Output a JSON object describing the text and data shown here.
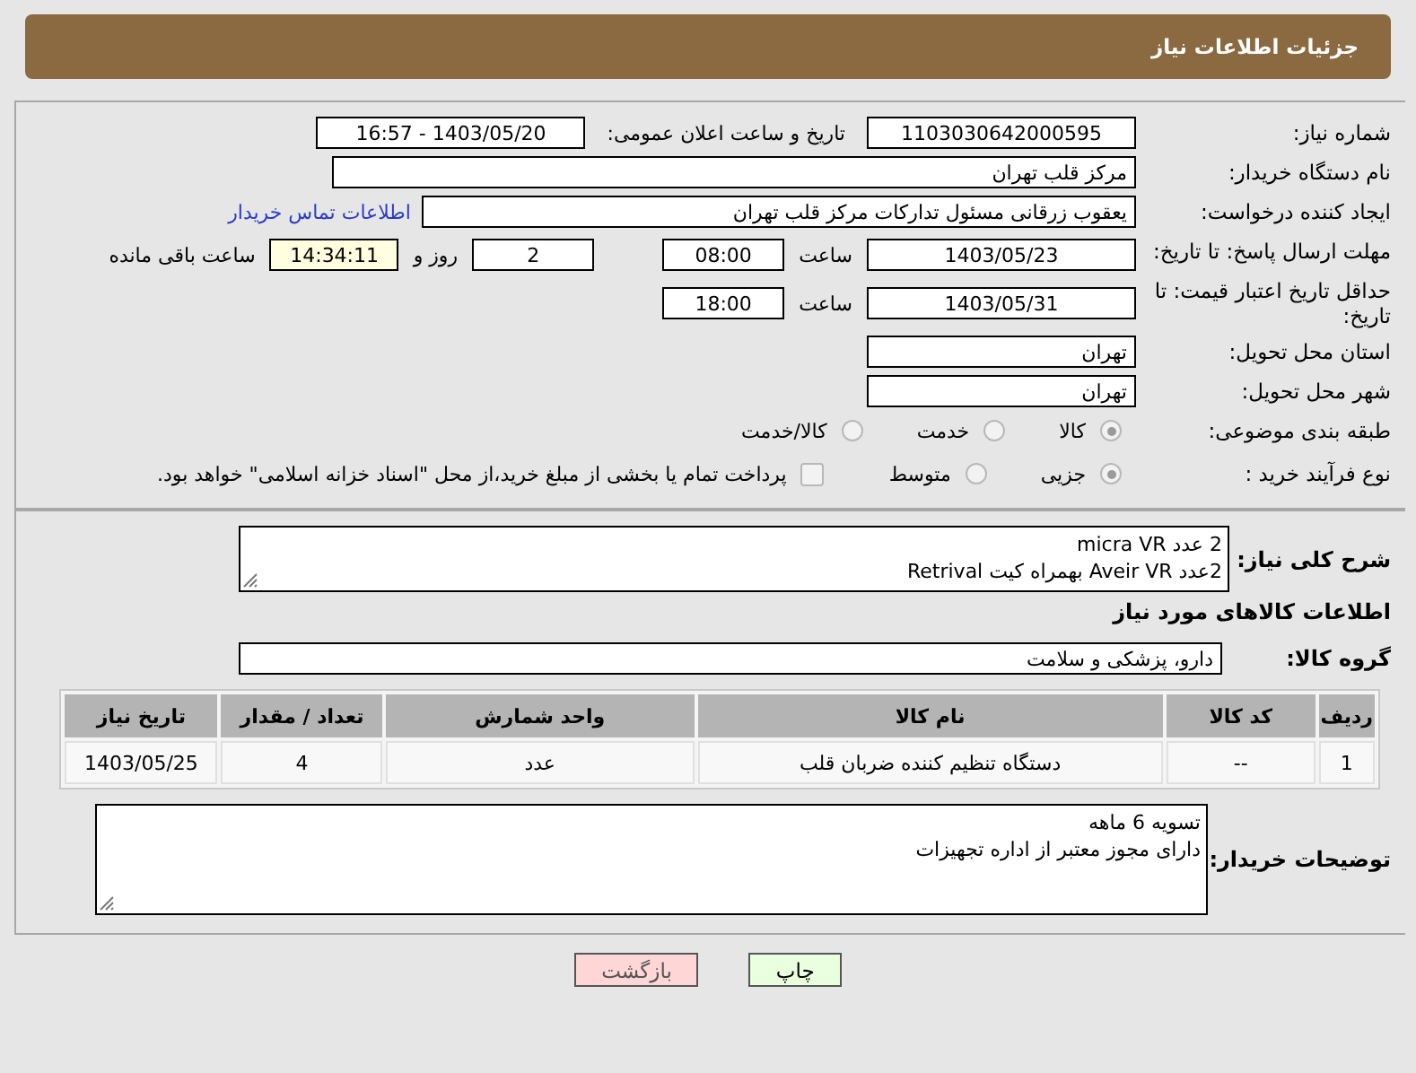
{
  "header": {
    "title": "جزئیات اطلاعات نیاز"
  },
  "need_number": {
    "label": "شماره نیاز:",
    "value": "1103030642000595"
  },
  "announce_datetime": {
    "label": "تاریخ و ساعت اعلان عمومی:",
    "value": "1403/05/20 - 16:57"
  },
  "buyer_org": {
    "label": "نام دستگاه خریدار:",
    "value": "مرکز قلب تهران"
  },
  "requester": {
    "label": "ایجاد کننده درخواست:",
    "value": "یعقوب زرقانی مسئول تدارکات مرکز قلب تهران",
    "link": "اطلاعات تماس خریدار"
  },
  "reply_deadline": {
    "label": "مهلت ارسال پاسخ: تا تاریخ:",
    "date": "1403/05/23",
    "time_label": "ساعت",
    "time": "08:00",
    "days": "2",
    "days_label": "روز و",
    "remaining": "14:34:11",
    "remaining_label": "ساعت باقی مانده"
  },
  "price_validity": {
    "label": "حداقل تاریخ اعتبار قیمت: تا تاریخ:",
    "date": "1403/05/31",
    "time_label": "ساعت",
    "time": "18:00"
  },
  "delivery_province": {
    "label": "استان محل تحویل:",
    "value": "تهران"
  },
  "delivery_city": {
    "label": "شهر محل تحویل:",
    "value": "تهران"
  },
  "category": {
    "label": "طبقه بندی موضوعی:",
    "options": [
      {
        "label": "کالا",
        "selected": true
      },
      {
        "label": "خدمت",
        "selected": false
      },
      {
        "label": "کالا/خدمت",
        "selected": false
      }
    ]
  },
  "purchase_process": {
    "label": "نوع فرآیند خرید :",
    "options": [
      {
        "label": "جزیی",
        "selected": true
      },
      {
        "label": "متوسط",
        "selected": false
      }
    ],
    "payment_note": {
      "label": "پرداخت تمام یا بخشی از مبلغ خرید،از محل \"اسناد خزانه اسلامی\" خواهد بود.",
      "checked": false
    }
  },
  "description": {
    "label": "شرح کلی نیاز:",
    "lines": [
      "2 عدد micra VR",
      "2عدد Aveir VR بهمراه کیت Retrival"
    ]
  },
  "goods_heading": "اطلاعات کالاهای مورد نیاز",
  "goods_group": {
    "label": "گروه کالا:",
    "value": "دارو، پزشکی و سلامت"
  },
  "table": {
    "columns": [
      "ردیف",
      "کد کالا",
      "نام کالا",
      "واحد شمارش",
      "تعداد / مقدار",
      "تاریخ نیاز"
    ],
    "rows": [
      [
        "1",
        "--",
        "دستگاه تنظیم کننده ضربان قلب",
        "عدد",
        "4",
        "1403/05/25"
      ]
    ]
  },
  "buyer_notes": {
    "label": "توضیحات خریدار:",
    "lines": [
      "تسویه 6 ماهه",
      "دارای مجوز معتبر از اداره تجهیزات"
    ]
  },
  "buttons": [
    {
      "label": "چاپ",
      "kind": "print"
    },
    {
      "label": "بازگشت",
      "kind": "back"
    }
  ]
}
